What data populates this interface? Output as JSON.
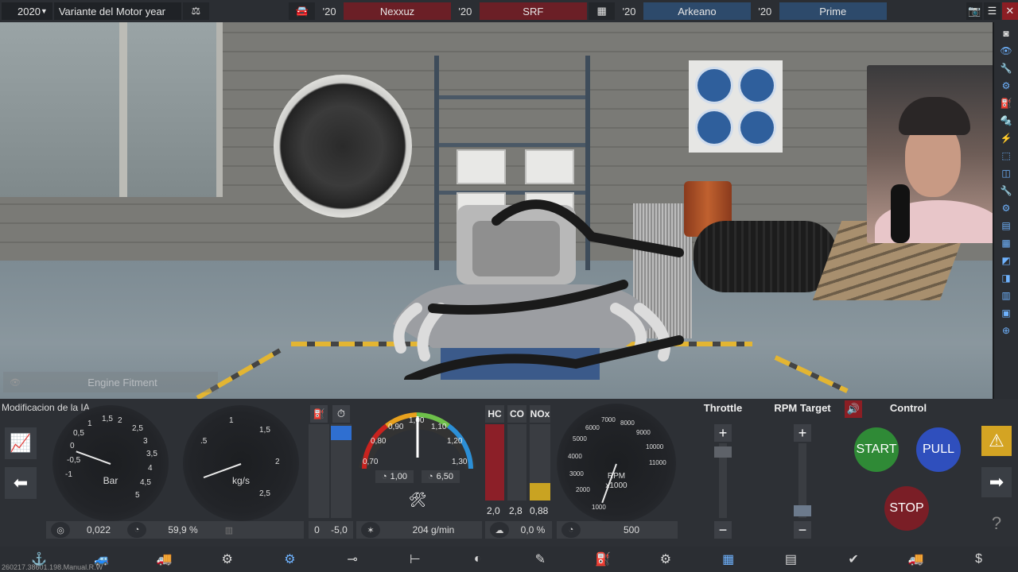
{
  "topbar": {
    "year": "2020",
    "variant": "Variante del Motor year",
    "rivals": [
      {
        "year": "'20",
        "name": "Nexxuz"
      },
      {
        "year": "'20",
        "name": "SRF"
      },
      {
        "year": "'20",
        "name": "Arkeano"
      },
      {
        "year": "'20",
        "name": "Prime"
      }
    ],
    "colors": {
      "red_team": "#6b1f26",
      "blue_team": "#2d4a6b"
    }
  },
  "fitment": {
    "label": "Engine Fitment"
  },
  "panel": {
    "title": "Modificacion de la IA",
    "boost_gauge": {
      "unit": "Bar",
      "ticks": [
        "-1",
        "-0,5",
        "0",
        "0,5",
        "1",
        "1,5",
        "2",
        "2,5",
        "3",
        "3,5",
        "4",
        "4,5",
        "5"
      ],
      "readout": "0,022"
    },
    "flow_gauge": {
      "unit": "kg/s",
      "ticks": [
        ".5",
        "1",
        "1,5",
        "2",
        "2,5"
      ],
      "readout": "59,9 %"
    },
    "fuel": {
      "readout_left": "0",
      "readout_right": "-5,0"
    },
    "afr_gauge": {
      "ticks": [
        "0,70",
        "0,80",
        "0,90",
        "1,00",
        "1,10",
        "1,20",
        "1,30"
      ],
      "setting1": "1,00",
      "setting2": "6,50",
      "readout": "204 g/min"
    },
    "emissions": {
      "labels": [
        "HC",
        "CO",
        "NOx"
      ],
      "values": [
        "2,0",
        "2,8",
        "0,88"
      ],
      "readout": "0,0 %"
    },
    "rpm_gauge": {
      "unit": "RPM",
      "unit2": "x1000",
      "ticks": [
        "1000",
        "2000",
        "3000",
        "4000",
        "5000",
        "6000",
        "7000",
        "8000",
        "9000",
        "10000",
        "11000"
      ],
      "readout": "500"
    },
    "throttle": {
      "label": "Throttle",
      "plus": "+",
      "minus": "−"
    },
    "rpm_target": {
      "label": "RPM Target",
      "plus": "+",
      "minus": "−"
    },
    "control": {
      "label": "Control",
      "start": "START",
      "pull": "PULL",
      "stop": "STOP"
    }
  },
  "version": "260217.38601.198.Manual.R.W"
}
